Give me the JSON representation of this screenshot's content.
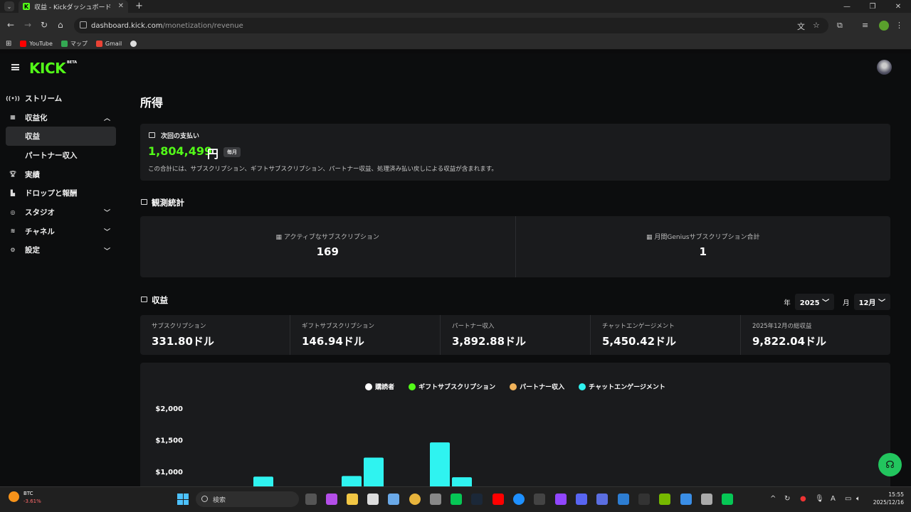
{
  "browser": {
    "tab_title": "収益 - Kickダッシュボード",
    "url_host": "dashboard.kick.com",
    "url_path": "/monetization/revenue",
    "bookmarks": [
      {
        "label": "YouTube",
        "color": "#ff0000"
      },
      {
        "label": "マップ",
        "color": "#34a853"
      },
      {
        "label": "Gmail",
        "color": "#ea4335"
      }
    ]
  },
  "app": {
    "logo": "KICK",
    "logo_badge": "BETA"
  },
  "sidebar": {
    "items": [
      {
        "label": "ストリーム",
        "icon": "broadcast-icon"
      },
      {
        "label": "収益化",
        "icon": "monetization-icon",
        "expanded": true
      },
      {
        "label": "収益",
        "active": true
      },
      {
        "label": "パートナー収入"
      },
      {
        "label": "実績",
        "icon": "trophy-icon"
      },
      {
        "label": "ドロップと報酬",
        "icon": "drops-icon"
      },
      {
        "label": "スタジオ",
        "icon": "studio-icon"
      },
      {
        "label": "チャネル",
        "icon": "channel-icon"
      },
      {
        "label": "設定",
        "icon": "gear-icon"
      }
    ]
  },
  "page": {
    "title": "所得"
  },
  "payout": {
    "label": "次回の支払い",
    "amount": "1,804,499",
    "currency": "円",
    "badge": "毎月",
    "description": "この合計には、サブスクリプション、ギフトサブスクリプション、パートナー収益、処理済み払い戻しによる収益が含まれます。"
  },
  "stats": {
    "title": "観測統計",
    "items": [
      {
        "label": "アクティブなサブスクリプション",
        "value": "169"
      },
      {
        "label": "月間Geniusサブスクリプション合計",
        "value": "1"
      }
    ]
  },
  "revenue": {
    "title": "収益",
    "year_label": "年",
    "year_value": "2025",
    "month_label": "月",
    "month_value": "12月",
    "items": [
      {
        "label": "サブスクリプション",
        "value": "331.80ドル"
      },
      {
        "label": "ギフトサブスクリプション",
        "value": "146.94ドル"
      },
      {
        "label": "パートナー収入",
        "value": "3,892.88ドル"
      },
      {
        "label": "チャットエンゲージメント",
        "value": "5,450.42ドル"
      },
      {
        "label": "2025年12月の総収益",
        "value": "9,822.04ドル"
      }
    ]
  },
  "chart_data": {
    "type": "bar",
    "series": [
      {
        "name": "購読者",
        "color": "#ffffff"
      },
      {
        "name": "ギフトサブスクリプション",
        "color": "#53fc18"
      },
      {
        "name": "パートナー収入",
        "color": "#f0b25a"
      },
      {
        "name": "チャットエンゲージメント",
        "color": "#2ff3f0",
        "values": [
          0,
          0,
          930,
          0,
          0,
          0,
          940,
          1230,
          0,
          0,
          1470,
          920
        ]
      }
    ],
    "ytick_labels": [
      "$2,000",
      "$1,500",
      "$1,000"
    ],
    "ylim": [
      0,
      2000
    ],
    "legend_position": "top-center"
  },
  "taskbar": {
    "ticker": "BTC",
    "ticker_change": "-3.61%",
    "search_placeholder": "検索",
    "time": "15:55",
    "date": "2025/12/16"
  }
}
